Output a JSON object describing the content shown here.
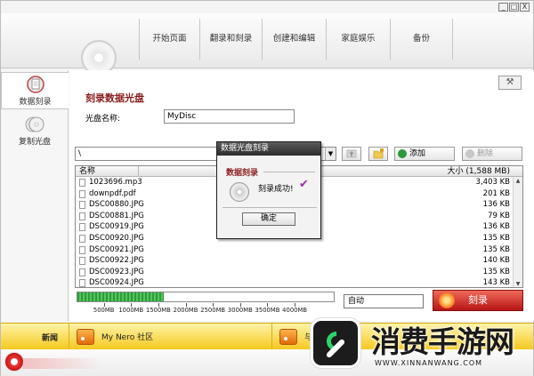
{
  "window": {
    "controls": [
      "_",
      "□",
      "X"
    ]
  },
  "nav": {
    "tabs": [
      {
        "label": "开始页面"
      },
      {
        "label": "翻录和刻录"
      },
      {
        "label": "创建和编辑"
      },
      {
        "label": "家庭娱乐"
      },
      {
        "label": "备份"
      }
    ]
  },
  "sidebar": {
    "items": [
      {
        "label": "数据刻录",
        "icon": "data-burn-icon",
        "active": true
      },
      {
        "label": "复制光盘",
        "icon": "copy-disc-icon",
        "active": false
      }
    ]
  },
  "main": {
    "title": "刻录数据光盘",
    "disc_name_label": "光盘名称:",
    "disc_name_value": "MyDisc",
    "path_value": "\\",
    "add_label": "添加",
    "delete_label": "删除",
    "help_icon": "hammer-icon"
  },
  "file_list": {
    "col_name": "名称",
    "col_size": "大小 (1,588 MB)",
    "rows": [
      {
        "name": "1023696.mp3",
        "size": "3,403 KB"
      },
      {
        "name": "downpdf.pdf",
        "size": "201 KB"
      },
      {
        "name": "DSC00880.JPG",
        "size": "136 KB"
      },
      {
        "name": "DSC00881.JPG",
        "size": "79 KB"
      },
      {
        "name": "DSC00919.JPG",
        "size": "136 KB"
      },
      {
        "name": "DSC00920.JPG",
        "size": "135 KB"
      },
      {
        "name": "DSC00921.JPG",
        "size": "135 KB"
      },
      {
        "name": "DSC00922.JPG",
        "size": "140 KB"
      },
      {
        "name": "DSC00923.JPG",
        "size": "135 KB"
      },
      {
        "name": "DSC00924.JPG",
        "size": "143 KB"
      }
    ]
  },
  "capacity": {
    "used_mb": 1588,
    "max_mb": 4700,
    "ticks": [
      "500MB",
      "1000MB",
      "1500MB",
      "2000MB",
      "2500MB",
      "3000MB",
      "3500MB",
      "4000MB"
    ],
    "tick_values": [
      500,
      1000,
      1500,
      2000,
      2500,
      3000,
      3500,
      4000
    ],
    "mode": "自动",
    "burn_label": "刻录"
  },
  "dialog": {
    "title": "数据光盘刻录",
    "subtitle": "数据刻录",
    "message": "刻录成功!",
    "check": "✔",
    "ok_label": "确定"
  },
  "news": {
    "label": "新闻",
    "tab1": "My Nero 社区",
    "tab2": "与"
  },
  "watermark": {
    "title": "消费手游网",
    "url": "WWW.XINNANWANG.COM"
  }
}
